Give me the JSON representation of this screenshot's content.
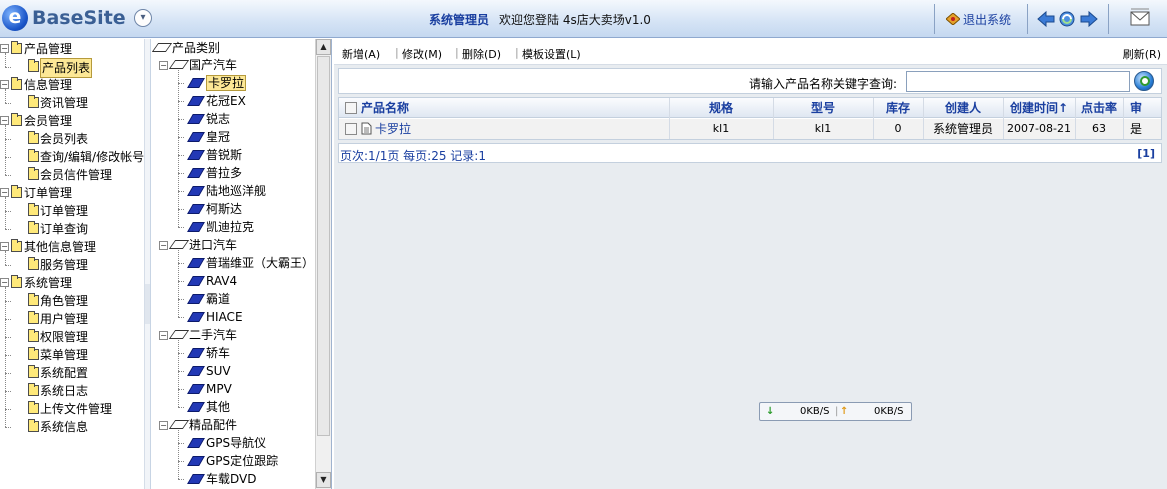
{
  "brand": {
    "logo_letter": "e",
    "name": "BaseSite"
  },
  "header": {
    "user_role": "系统管理员",
    "welcome": "欢迎您登陆 4s店大卖场v1.0",
    "logout_label": "退出系统"
  },
  "left_nav": [
    {
      "label": "产品管理",
      "children": [
        {
          "label": "产品列表",
          "selected": true
        }
      ]
    },
    {
      "label": "信息管理",
      "children": [
        {
          "label": "资讯管理"
        }
      ]
    },
    {
      "label": "会员管理",
      "children": [
        {
          "label": "会员列表"
        },
        {
          "label": "查询/编辑/修改帐号"
        },
        {
          "label": "会员信件管理"
        }
      ]
    },
    {
      "label": "订单管理",
      "children": [
        {
          "label": "订单管理"
        },
        {
          "label": "订单查询"
        }
      ]
    },
    {
      "label": "其他信息管理",
      "children": [
        {
          "label": "服务管理"
        }
      ]
    },
    {
      "label": "系统管理",
      "children": [
        {
          "label": "角色管理"
        },
        {
          "label": "用户管理"
        },
        {
          "label": "权限管理"
        },
        {
          "label": "菜单管理"
        },
        {
          "label": "系统配置"
        },
        {
          "label": "系统日志"
        },
        {
          "label": "上传文件管理"
        },
        {
          "label": "系统信息"
        }
      ]
    }
  ],
  "category_tree": {
    "root": "产品类别",
    "groups": [
      {
        "label": "国产汽车",
        "items": [
          "卡罗拉",
          "花冠EX",
          "锐志",
          "皇冠",
          "普锐斯",
          "普拉多",
          "陆地巡洋舰",
          "柯斯达",
          "凯迪拉克"
        ]
      },
      {
        "label": "进口汽车",
        "items": [
          "普瑞维亚（大霸王）",
          "RAV4",
          "霸道",
          "HIACE"
        ]
      },
      {
        "label": "二手汽车",
        "items": [
          "轿车",
          "SUV",
          "MPV",
          "其他"
        ]
      },
      {
        "label": "精品配件",
        "items": [
          "GPS导航仪",
          "GPS定位跟踪",
          "车载DVD"
        ]
      }
    ],
    "selected": "卡罗拉"
  },
  "toolbar": {
    "add": "新增(A)",
    "edit": "修改(M)",
    "delete": "删除(D)",
    "template": "模板设置(L)",
    "refresh": "刷新(R)"
  },
  "search": {
    "label": "请输入产品名称关键字查询:",
    "value": ""
  },
  "table": {
    "columns": [
      "产品名称",
      "规格",
      "型号",
      "库存",
      "创建人",
      "创建时间",
      "点击率",
      "审"
    ],
    "sort_indicator": "↑",
    "rows": [
      {
        "name": "卡罗拉",
        "spec": "kl1",
        "model": "kl1",
        "stock": "0",
        "creator": "系统管理员",
        "created": "2007-08-21",
        "hits": "63",
        "audit": "是"
      }
    ]
  },
  "pager": {
    "text": "页次:1/1页 每页:25 记录:1",
    "current": "[1]"
  },
  "speed": {
    "down": "0KB/S",
    "up": "0KB/S"
  },
  "colors": {
    "link": "#1a3fa0",
    "header_bg": "#d4e3f5",
    "selected_bg": "#fde896"
  }
}
